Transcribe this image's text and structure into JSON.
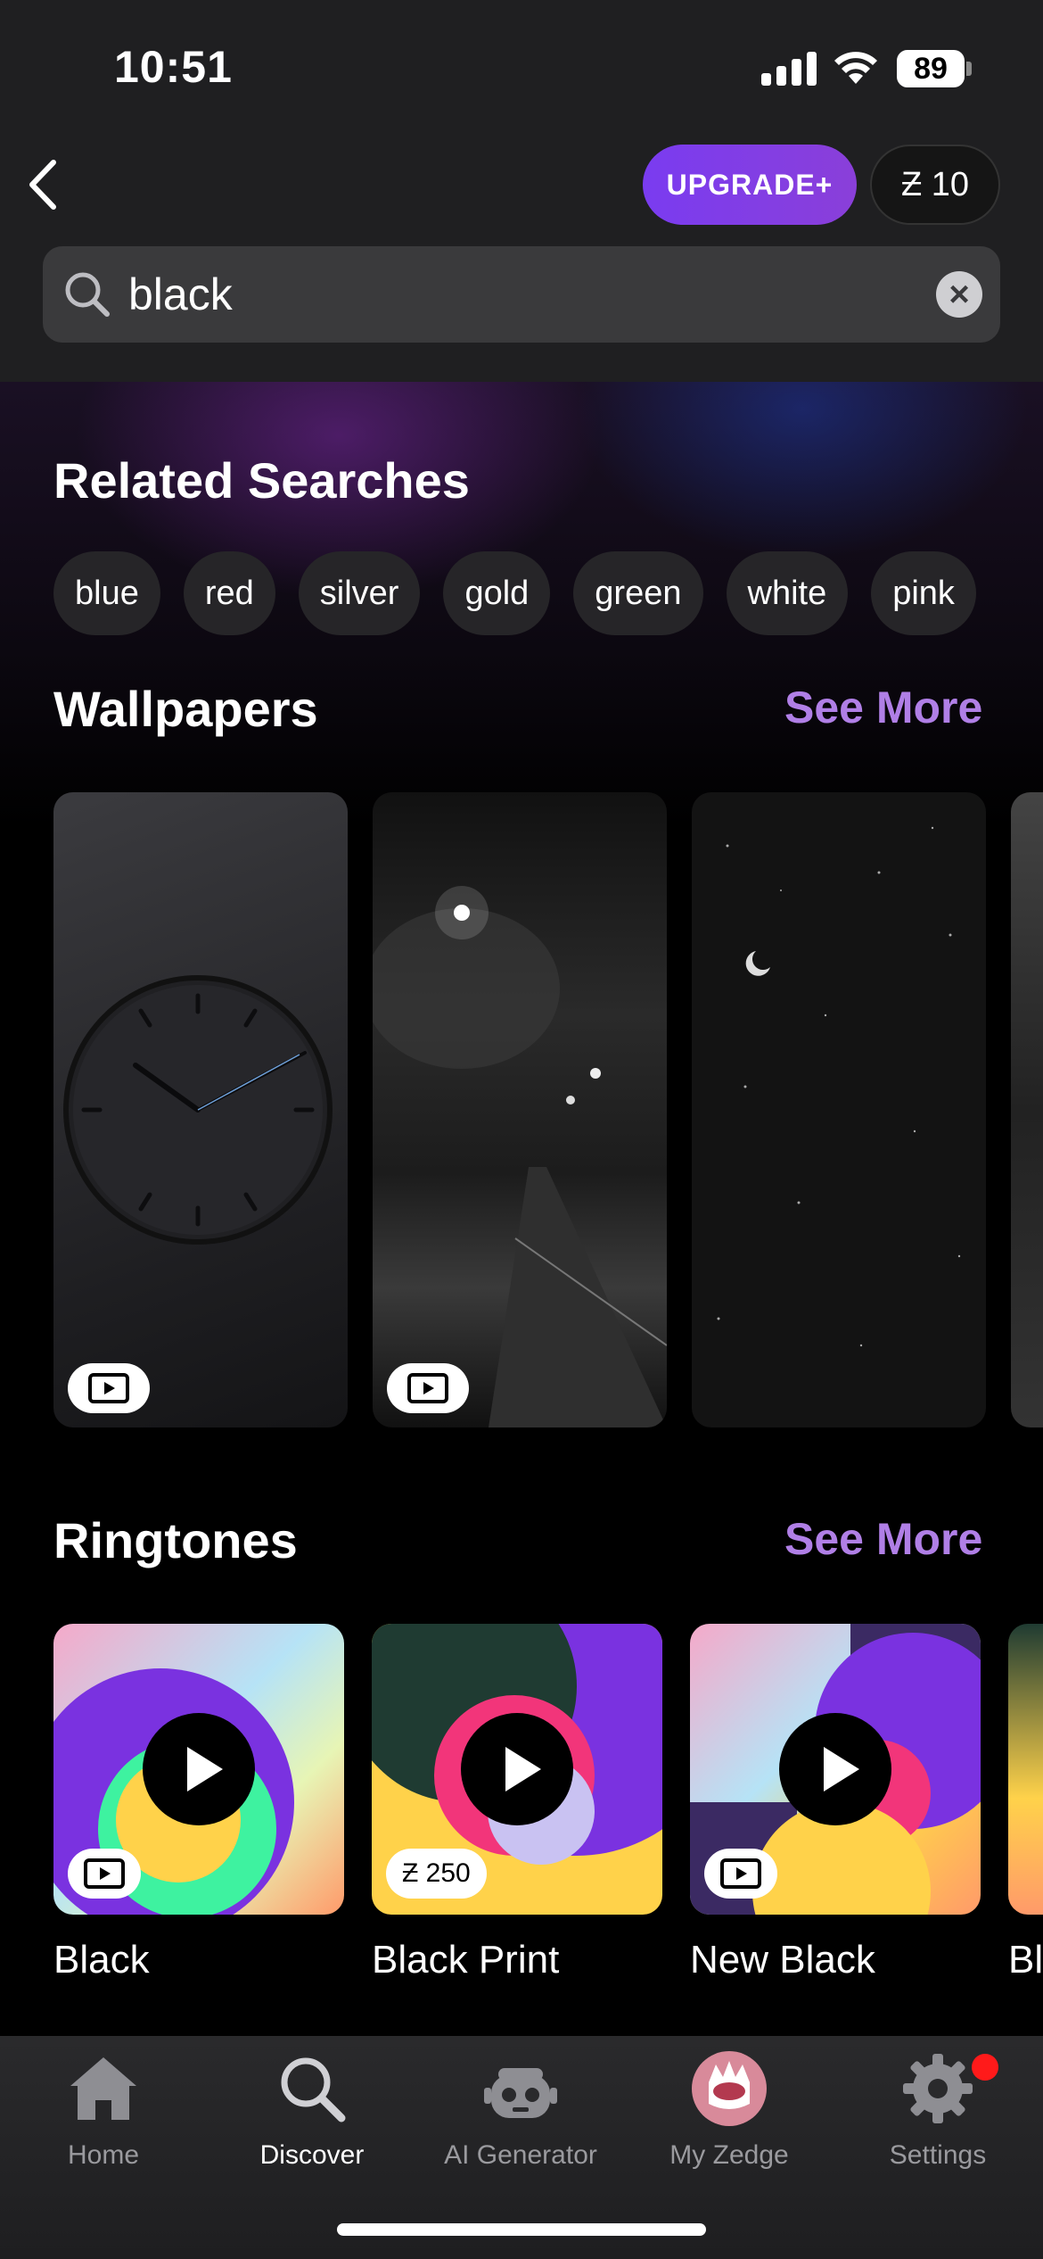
{
  "status_bar": {
    "time": "10:51",
    "battery": "89"
  },
  "header": {
    "upgrade_label": "UPGRADE+",
    "coins_label": "Ƶ 10",
    "search_value": "black"
  },
  "related": {
    "title": "Related Searches",
    "chips": [
      "blue",
      "red",
      "silver",
      "gold",
      "green",
      "white",
      "pink"
    ]
  },
  "wallpapers": {
    "title": "Wallpapers",
    "see_more": "See More"
  },
  "ringtones": {
    "title": "Ringtones",
    "see_more": "See More",
    "items": [
      {
        "title": "Black"
      },
      {
        "title": "Black Print",
        "price": "Ƶ 250"
      },
      {
        "title": "New Black"
      },
      {
        "title": "Bl"
      }
    ]
  },
  "tabs": [
    {
      "label": "Home",
      "icon": "home-icon"
    },
    {
      "label": "Discover",
      "icon": "search-icon"
    },
    {
      "label": "AI Generator",
      "icon": "robot-icon"
    },
    {
      "label": "My Zedge",
      "icon": "zedge-avatar-icon"
    },
    {
      "label": "Settings",
      "icon": "gear-icon"
    }
  ],
  "colors": {
    "accent": "#b07fe6",
    "upgrade": "#7a3cf0",
    "notification": "#ff1a1a"
  }
}
